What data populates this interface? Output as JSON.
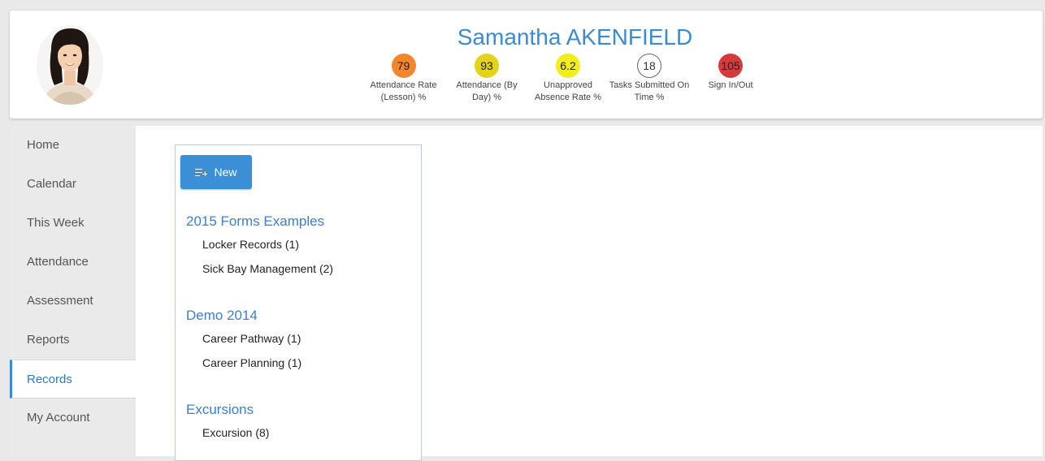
{
  "student": {
    "name": "Samantha AKENFIELD"
  },
  "stats": [
    {
      "value": "79",
      "label": "Attendance Rate (Lesson) %",
      "color": "#f0872e"
    },
    {
      "value": "93",
      "label": "Attendance (By Day) %",
      "color": "#e5d21a"
    },
    {
      "value": "6.2",
      "label": "Unapproved Absence Rate %",
      "color": "#f2ec20"
    },
    {
      "value": "18",
      "label": "Tasks Submitted On Time %",
      "color": "#ffffff"
    },
    {
      "value": "105",
      "label": "Sign In/Out",
      "color": "#d63b3b"
    }
  ],
  "nav": {
    "items": [
      {
        "label": "Home"
      },
      {
        "label": "Calendar"
      },
      {
        "label": "This Week"
      },
      {
        "label": "Attendance"
      },
      {
        "label": "Assessment"
      },
      {
        "label": "Reports"
      },
      {
        "label": "Records"
      },
      {
        "label": "My Account"
      }
    ],
    "active": "Records"
  },
  "records": {
    "new_button": "New",
    "groups": [
      {
        "title": "2015 Forms Examples",
        "items": [
          "Locker Records (1)",
          "Sick Bay Management (2)"
        ]
      },
      {
        "title": "Demo 2014",
        "items": [
          "Career Pathway (1)",
          "Career Planning (1)"
        ]
      },
      {
        "title": "Excursions",
        "items": [
          "Excursion (8)"
        ]
      }
    ]
  },
  "colors": {
    "accent": "#3b8bd1",
    "group_title": "#3d7ed0",
    "button": "#3b8fd6"
  }
}
